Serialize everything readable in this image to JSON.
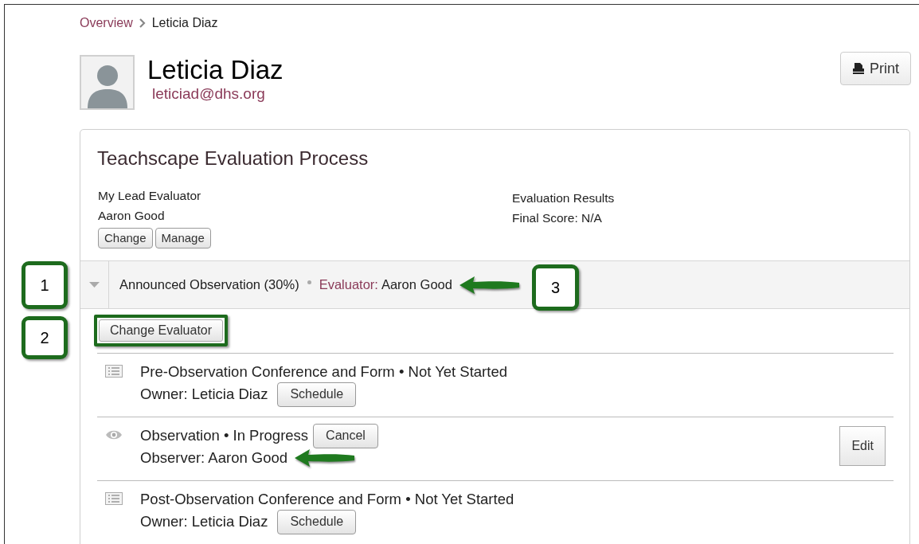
{
  "breadcrumb": [
    {
      "label": "Overview",
      "link": true
    },
    {
      "label": "Leticia Diaz",
      "link": false
    }
  ],
  "profile": {
    "name": "Leticia Diaz",
    "email": "leticiad@dhs.org"
  },
  "print_button": "Print",
  "process": {
    "title": "Teachscape Evaluation Process",
    "lead": {
      "heading": "My Lead Evaluator",
      "name": "Aaron Good",
      "buttons": [
        "Change",
        "Manage"
      ]
    },
    "results": {
      "heading": "Evaluation Results",
      "score": "Final Score: N/A"
    },
    "section": {
      "expanded": true,
      "title": "Announced Observation (30%)",
      "evaluator_label": "Evaluator:",
      "evaluator": "Aaron Good",
      "arrow": true,
      "change_button": {
        "label": "Change Evaluator",
        "highlighted": true
      },
      "steps": [
        {
          "kind": "form",
          "title": "Pre-Observation Conference and Form • Not Yet Started",
          "detail": "Owner: Leticia Diaz",
          "detail_button": "Schedule",
          "arrow": false
        },
        {
          "kind": "observation",
          "title": "Observation • In Progress",
          "title_button": "Cancel",
          "detail": "Observer: Aaron Good",
          "side_button": "Edit",
          "arrow": true
        },
        {
          "kind": "form",
          "title": "Post-Observation Conference and Form • Not Yet Started",
          "detail": "Owner: Leticia Diaz",
          "detail_button": "Schedule",
          "arrow": false
        }
      ]
    }
  },
  "callouts": [
    {
      "label": "1"
    },
    {
      "label": "2"
    },
    {
      "label": "3"
    }
  ]
}
